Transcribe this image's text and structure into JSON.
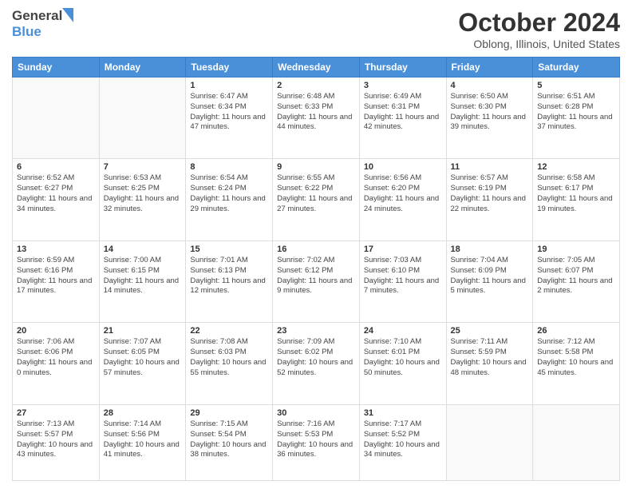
{
  "header": {
    "logo_general": "General",
    "logo_blue": "Blue",
    "month_title": "October 2024",
    "location": "Oblong, Illinois, United States"
  },
  "days_of_week": [
    "Sunday",
    "Monday",
    "Tuesday",
    "Wednesday",
    "Thursday",
    "Friday",
    "Saturday"
  ],
  "weeks": [
    [
      {
        "day": "",
        "info": ""
      },
      {
        "day": "",
        "info": ""
      },
      {
        "day": "1",
        "info": "Sunrise: 6:47 AM\nSunset: 6:34 PM\nDaylight: 11 hours and 47 minutes."
      },
      {
        "day": "2",
        "info": "Sunrise: 6:48 AM\nSunset: 6:33 PM\nDaylight: 11 hours and 44 minutes."
      },
      {
        "day": "3",
        "info": "Sunrise: 6:49 AM\nSunset: 6:31 PM\nDaylight: 11 hours and 42 minutes."
      },
      {
        "day": "4",
        "info": "Sunrise: 6:50 AM\nSunset: 6:30 PM\nDaylight: 11 hours and 39 minutes."
      },
      {
        "day": "5",
        "info": "Sunrise: 6:51 AM\nSunset: 6:28 PM\nDaylight: 11 hours and 37 minutes."
      }
    ],
    [
      {
        "day": "6",
        "info": "Sunrise: 6:52 AM\nSunset: 6:27 PM\nDaylight: 11 hours and 34 minutes."
      },
      {
        "day": "7",
        "info": "Sunrise: 6:53 AM\nSunset: 6:25 PM\nDaylight: 11 hours and 32 minutes."
      },
      {
        "day": "8",
        "info": "Sunrise: 6:54 AM\nSunset: 6:24 PM\nDaylight: 11 hours and 29 minutes."
      },
      {
        "day": "9",
        "info": "Sunrise: 6:55 AM\nSunset: 6:22 PM\nDaylight: 11 hours and 27 minutes."
      },
      {
        "day": "10",
        "info": "Sunrise: 6:56 AM\nSunset: 6:20 PM\nDaylight: 11 hours and 24 minutes."
      },
      {
        "day": "11",
        "info": "Sunrise: 6:57 AM\nSunset: 6:19 PM\nDaylight: 11 hours and 22 minutes."
      },
      {
        "day": "12",
        "info": "Sunrise: 6:58 AM\nSunset: 6:17 PM\nDaylight: 11 hours and 19 minutes."
      }
    ],
    [
      {
        "day": "13",
        "info": "Sunrise: 6:59 AM\nSunset: 6:16 PM\nDaylight: 11 hours and 17 minutes."
      },
      {
        "day": "14",
        "info": "Sunrise: 7:00 AM\nSunset: 6:15 PM\nDaylight: 11 hours and 14 minutes."
      },
      {
        "day": "15",
        "info": "Sunrise: 7:01 AM\nSunset: 6:13 PM\nDaylight: 11 hours and 12 minutes."
      },
      {
        "day": "16",
        "info": "Sunrise: 7:02 AM\nSunset: 6:12 PM\nDaylight: 11 hours and 9 minutes."
      },
      {
        "day": "17",
        "info": "Sunrise: 7:03 AM\nSunset: 6:10 PM\nDaylight: 11 hours and 7 minutes."
      },
      {
        "day": "18",
        "info": "Sunrise: 7:04 AM\nSunset: 6:09 PM\nDaylight: 11 hours and 5 minutes."
      },
      {
        "day": "19",
        "info": "Sunrise: 7:05 AM\nSunset: 6:07 PM\nDaylight: 11 hours and 2 minutes."
      }
    ],
    [
      {
        "day": "20",
        "info": "Sunrise: 7:06 AM\nSunset: 6:06 PM\nDaylight: 11 hours and 0 minutes."
      },
      {
        "day": "21",
        "info": "Sunrise: 7:07 AM\nSunset: 6:05 PM\nDaylight: 10 hours and 57 minutes."
      },
      {
        "day": "22",
        "info": "Sunrise: 7:08 AM\nSunset: 6:03 PM\nDaylight: 10 hours and 55 minutes."
      },
      {
        "day": "23",
        "info": "Sunrise: 7:09 AM\nSunset: 6:02 PM\nDaylight: 10 hours and 52 minutes."
      },
      {
        "day": "24",
        "info": "Sunrise: 7:10 AM\nSunset: 6:01 PM\nDaylight: 10 hours and 50 minutes."
      },
      {
        "day": "25",
        "info": "Sunrise: 7:11 AM\nSunset: 5:59 PM\nDaylight: 10 hours and 48 minutes."
      },
      {
        "day": "26",
        "info": "Sunrise: 7:12 AM\nSunset: 5:58 PM\nDaylight: 10 hours and 45 minutes."
      }
    ],
    [
      {
        "day": "27",
        "info": "Sunrise: 7:13 AM\nSunset: 5:57 PM\nDaylight: 10 hours and 43 minutes."
      },
      {
        "day": "28",
        "info": "Sunrise: 7:14 AM\nSunset: 5:56 PM\nDaylight: 10 hours and 41 minutes."
      },
      {
        "day": "29",
        "info": "Sunrise: 7:15 AM\nSunset: 5:54 PM\nDaylight: 10 hours and 38 minutes."
      },
      {
        "day": "30",
        "info": "Sunrise: 7:16 AM\nSunset: 5:53 PM\nDaylight: 10 hours and 36 minutes."
      },
      {
        "day": "31",
        "info": "Sunrise: 7:17 AM\nSunset: 5:52 PM\nDaylight: 10 hours and 34 minutes."
      },
      {
        "day": "",
        "info": ""
      },
      {
        "day": "",
        "info": ""
      }
    ]
  ]
}
